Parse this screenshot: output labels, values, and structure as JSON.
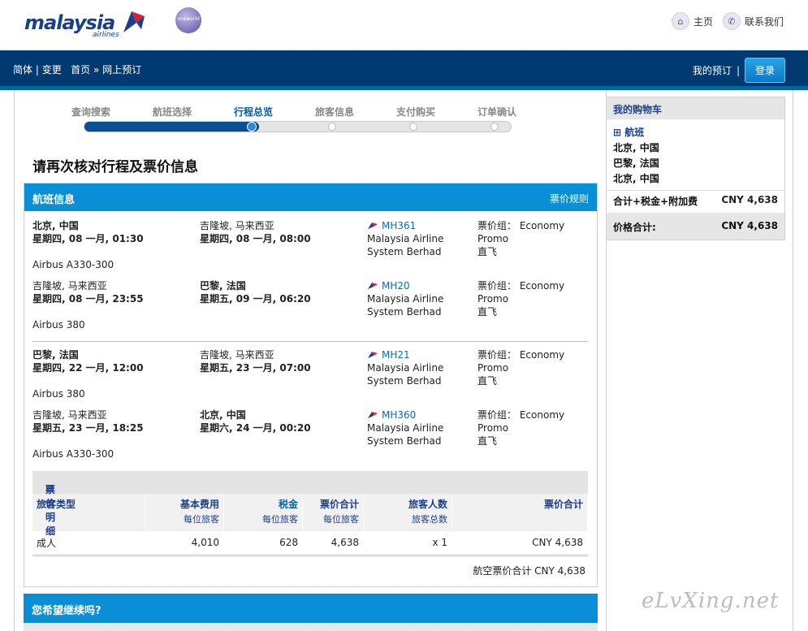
{
  "header": {
    "logo_text": "malaysia",
    "logo_sub": "airlines",
    "alliance_badge": "oneworld",
    "home_icon": "home-icon",
    "home_label": "主页",
    "contact_icon": "phone-icon",
    "contact_label": "联系我们"
  },
  "nav": {
    "lang": "简体",
    "change": "变更",
    "home": "首页",
    "current": "网上预订",
    "my_booking": "我的预订",
    "login": "登录"
  },
  "steps": [
    {
      "label": "查询搜索",
      "state": "done"
    },
    {
      "label": "航班选择",
      "state": "done"
    },
    {
      "label": "行程总览",
      "state": "active"
    },
    {
      "label": "旅客信息",
      "state": "todo"
    },
    {
      "label": "支付购买",
      "state": "todo"
    },
    {
      "label": "订单确认",
      "state": "todo"
    }
  ],
  "page_title": "请再次核对行程及票价信息",
  "flight_info": {
    "title": "航班信息",
    "fare_rules": "票价规则",
    "journeys": [
      {
        "segments": [
          {
            "from_city": "北京, 中国",
            "from_time": "星期四, 08 一月, 01:30",
            "to_city": "吉隆坡, 马来西亚",
            "to_time": "星期四, 08 一月, 08:00",
            "flight_no": "MH361",
            "airline_1": "Malaysia Airline",
            "airline_2": "System Berhad",
            "fare_label": "票价组：",
            "fare_class": "Economy",
            "fare_type": "Promo",
            "direct": "直飞",
            "aircraft": "Airbus A330-300"
          },
          {
            "from_city": "吉隆坡, 马来西亚",
            "from_time": "星期四, 08 一月, 23:55",
            "to_city": "巴黎, 法国",
            "to_time": "星期五, 09 一月, 06:20",
            "flight_no": "MH20",
            "airline_1": "Malaysia Airline",
            "airline_2": "System Berhad",
            "fare_label": "票价组：",
            "fare_class": "Economy",
            "fare_type": "Promo",
            "direct": "直飞",
            "aircraft": "Airbus 380"
          }
        ]
      },
      {
        "segments": [
          {
            "from_city": "巴黎, 法国",
            "from_time": "星期四, 22 一月, 12:00",
            "to_city": "吉隆坡, 马来西亚",
            "to_time": "星期五, 23 一月, 07:00",
            "flight_no": "MH21",
            "airline_1": "Malaysia Airline",
            "airline_2": "System Berhad",
            "fare_label": "票价组：",
            "fare_class": "Economy",
            "fare_type": "Promo",
            "direct": "直飞",
            "aircraft": "Airbus 380"
          },
          {
            "from_city": "吉隆坡, 马来西亚",
            "from_time": "星期五, 23 一月, 18:25",
            "to_city": "北京, 中国",
            "to_time": "星期六, 24 一月, 00:20",
            "flight_no": "MH360",
            "airline_1": "Malaysia Airline",
            "airline_2": "System Berhad",
            "fare_label": "票价组：",
            "fare_class": "Economy",
            "fare_type": "Promo",
            "direct": "直飞",
            "aircraft": "Airbus A330-300"
          }
        ]
      }
    ]
  },
  "price_detail": {
    "toggle": "⊟",
    "title": "票价明细",
    "columns": [
      {
        "main": "旅客类型",
        "sub": ""
      },
      {
        "main": "基本费用",
        "sub": "每位旅客"
      },
      {
        "main": "税金",
        "sub": "每位旅客"
      },
      {
        "main": "票价合计",
        "sub": "每位旅客"
      },
      {
        "main": "旅客人数",
        "sub": "旅客总数"
      },
      {
        "main": "票价合计",
        "sub": ""
      }
    ],
    "rows": [
      {
        "type": "成人",
        "base": "4,010",
        "tax": "628",
        "total": "4,638",
        "count": "x 1",
        "sum": "CNY 4,638"
      }
    ],
    "grand_total": "航空票价合计 CNY 4,638"
  },
  "continue_title": "您希望继续吗?",
  "cart": {
    "title": "我的购物车",
    "toggle": "⊞",
    "section": "航班",
    "cities": [
      "北京, 中国",
      "巴黎, 法国",
      "北京, 中国"
    ],
    "sum_label": "合计+税金+附加费",
    "sum_value": "CNY 4,638",
    "total_label": "价格合计:",
    "total_value": "CNY 4,638"
  },
  "watermark": "eLvXing.net"
}
